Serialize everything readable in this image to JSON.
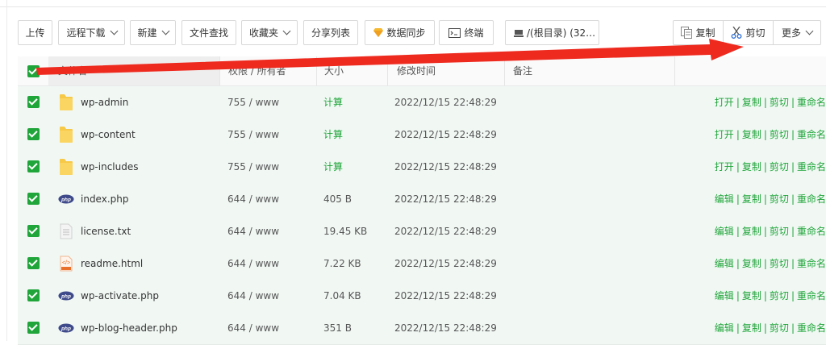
{
  "toolbar": {
    "upload": "上传",
    "remote_download": "远程下载",
    "new": "新建",
    "file_search": "文件查找",
    "favorites": "收藏夹",
    "share_list": "分享列表",
    "data_sync": "数据同步",
    "terminal": "终端",
    "disk": "/(根目录) (32…",
    "copy": "复制",
    "cut": "剪切",
    "more": "更多"
  },
  "table": {
    "headers": {
      "name": "文件名",
      "perm": "权限 / 所有者",
      "size": "大小",
      "mtime": "修改时间",
      "note": "备注"
    },
    "rows": [
      {
        "name": "wp-admin",
        "icon": "folder-icon",
        "perm": "755 / www",
        "size": "计算",
        "mtime": "2022/12/15 22:48:29",
        "op1": "打开",
        "op2": "复制",
        "op3": "剪切",
        "op4": "重命名"
      },
      {
        "name": "wp-content",
        "icon": "folder-icon",
        "perm": "755 / www",
        "size": "计算",
        "mtime": "2022/12/15 22:48:29",
        "op1": "打开",
        "op2": "复制",
        "op3": "剪切",
        "op4": "重命名"
      },
      {
        "name": "wp-includes",
        "icon": "folder-icon",
        "perm": "755 / www",
        "size": "计算",
        "mtime": "2022/12/15 22:48:29",
        "op1": "打开",
        "op2": "复制",
        "op3": "剪切",
        "op4": "重命名"
      },
      {
        "name": "index.php",
        "icon": "php-file-icon",
        "perm": "644 / www",
        "size": "405 B",
        "mtime": "2022/12/15 22:48:29",
        "op1": "编辑",
        "op2": "复制",
        "op3": "剪切",
        "op4": "重命名"
      },
      {
        "name": "license.txt",
        "icon": "text-file-icon",
        "perm": "644 / www",
        "size": "19.45 KB",
        "mtime": "2022/12/15 22:48:29",
        "op1": "编辑",
        "op2": "复制",
        "op3": "剪切",
        "op4": "重命名"
      },
      {
        "name": "readme.html",
        "icon": "html-file-icon",
        "perm": "644 / www",
        "size": "7.22 KB",
        "mtime": "2022/12/15 22:48:29",
        "op1": "编辑",
        "op2": "复制",
        "op3": "剪切",
        "op4": "重命名"
      },
      {
        "name": "wp-activate.php",
        "icon": "php-file-icon",
        "perm": "644 / www",
        "size": "7.04 KB",
        "mtime": "2022/12/15 22:48:29",
        "op1": "编辑",
        "op2": "复制",
        "op3": "剪切",
        "op4": "重命名"
      },
      {
        "name": "wp-blog-header.php",
        "icon": "php-file-icon",
        "perm": "644 / www",
        "size": "351 B",
        "mtime": "2022/12/15 22:48:29",
        "op1": "编辑",
        "op2": "复制",
        "op3": "剪切",
        "op4": "重命名"
      }
    ]
  },
  "colors": {
    "accent": "#20a53a",
    "row_bg": "#f1f8f4",
    "annotation_arrow": "#ee2a1f"
  },
  "separator": "|"
}
